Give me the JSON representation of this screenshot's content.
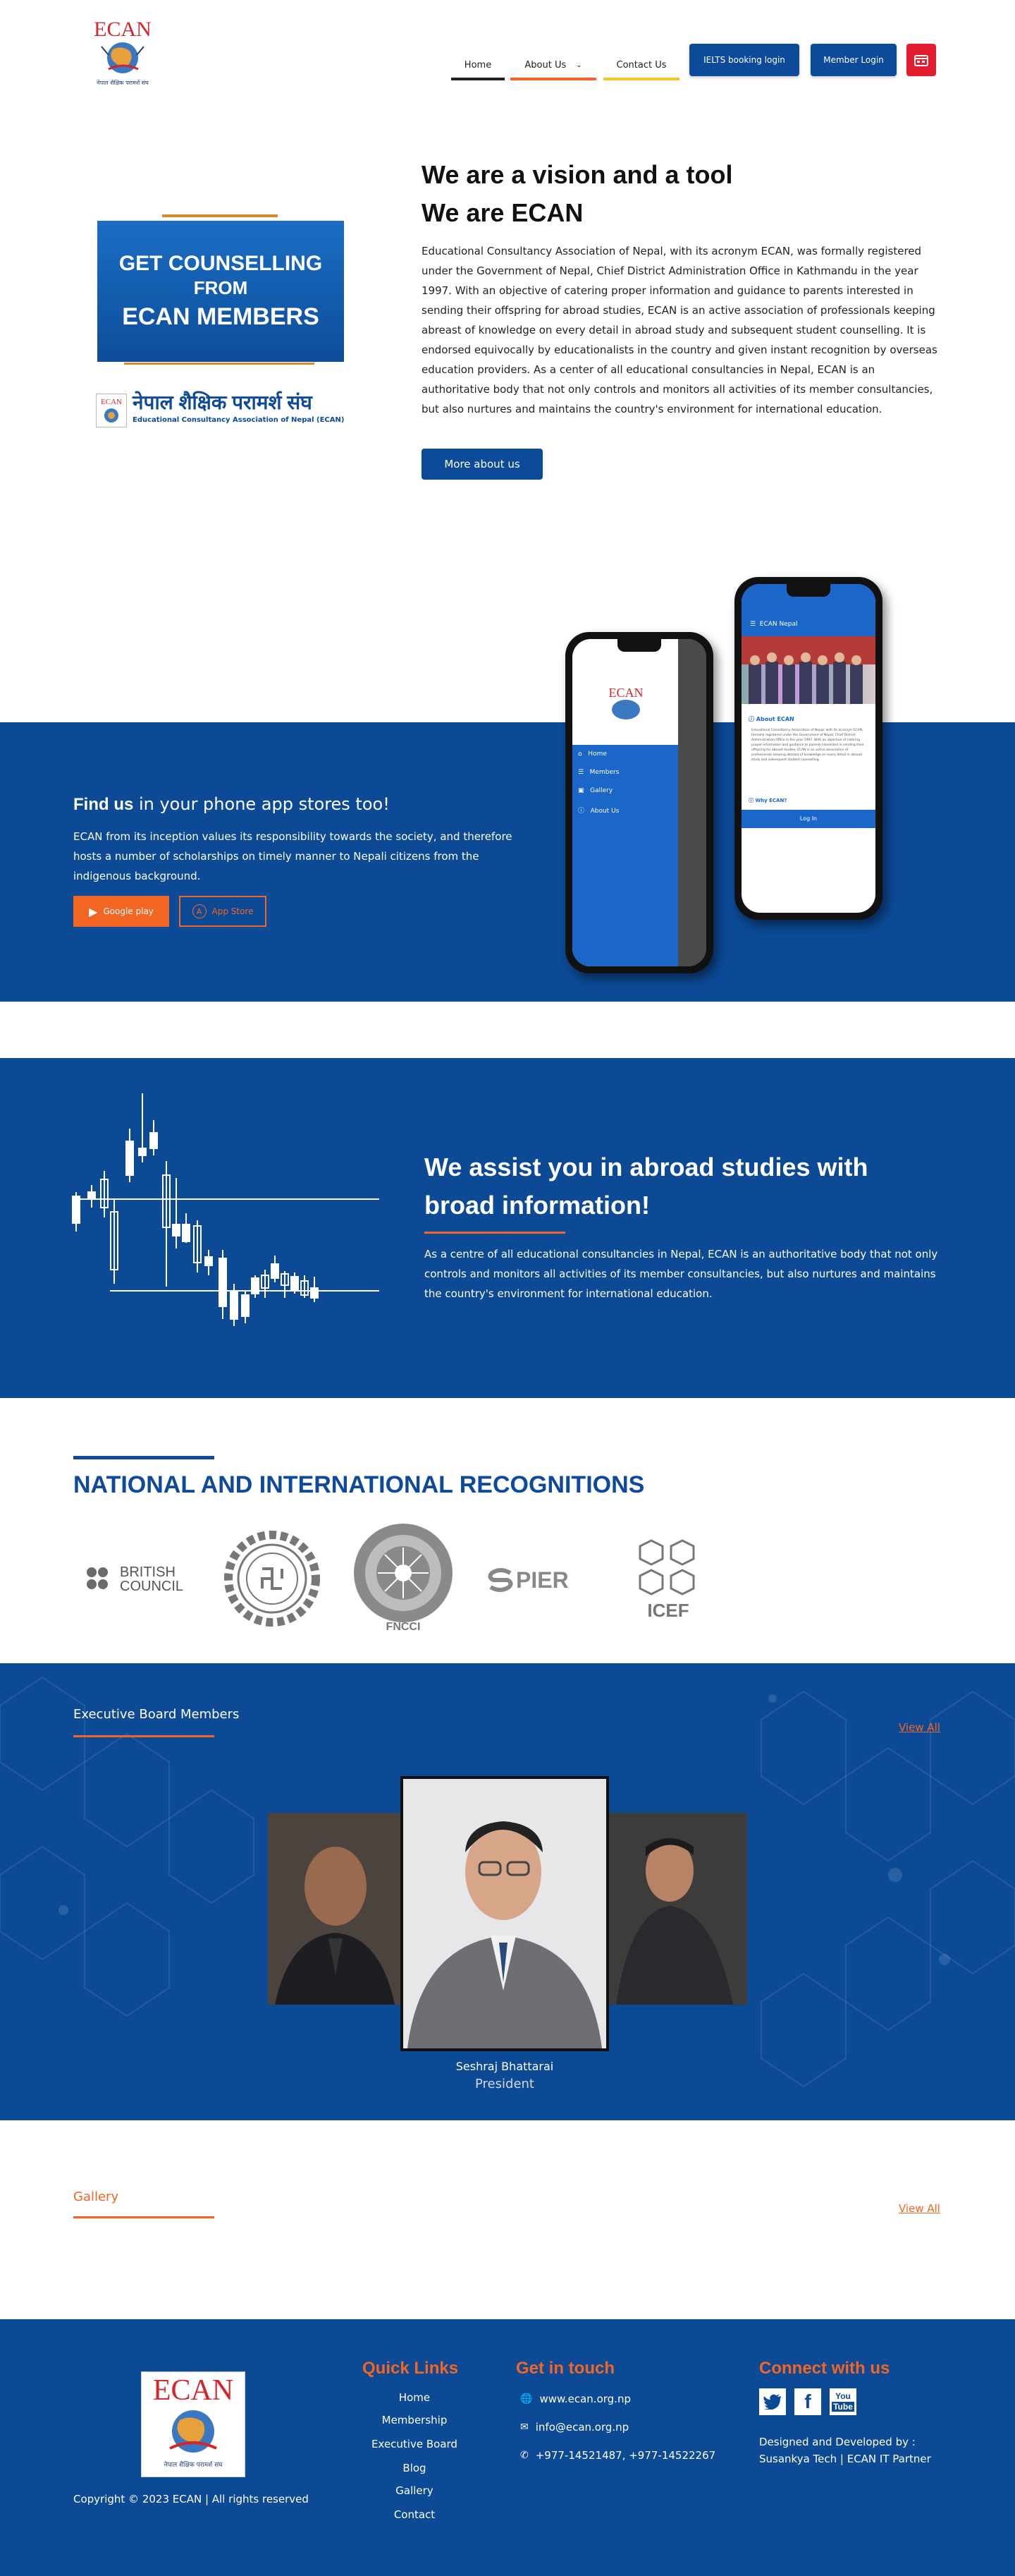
{
  "header": {
    "logo_text": "ECAN",
    "logo_sub": "नेपाल शैक्षिक परामर्श संघ",
    "nav": [
      {
        "label": "Home",
        "color": "#222222"
      },
      {
        "label": "About Us",
        "color": "#f26522"
      },
      {
        "label": "Contact Us",
        "color": "#f7c51d"
      }
    ],
    "ielts_label": "IELTS booking login",
    "member_label": "Member Login",
    "calendar_icon": "calendar-icon"
  },
  "about": {
    "counsel_line1": "GET COUNSELLING",
    "counsel_line2": "FROM",
    "counsel_line3": "ECAN MEMBERS",
    "ecan_nepali": "नेपाल शैक्षिक परामर्श संघ",
    "ecan_english": "Educational Consultancy Association of Nepal (ECAN)",
    "title1": "We are a vision and a tool",
    "title2": "We are ECAN",
    "paragraph": "Educational Consultancy Association of Nepal, with its acronym ECAN, was formally registered under the Government of Nepal, Chief District Administration Office in Kathmandu in the year 1997. With an objective of catering proper information and guidance to parents interested in sending their offspring for abroad studies, ECAN is an active association of professionals keeping abreast of knowledge on every detail in abroad study and subsequent student counselling. It is endorsed equivocally by educationalists in the country and given instant recognition by overseas education providers. As a center of all educational consultancies in Nepal, ECAN is an authoritative body that not only controls and monitors all activities of its member consultancies, but also nurtures and maintains the country's environment for international education.",
    "more_btn": "More about us"
  },
  "app": {
    "title_bold": "Find us",
    "title_rest": " in your phone app stores too!",
    "paragraph": "ECAN from its inception values its responsibility towards the society, and therefore hosts a number of scholarships on timely manner to Nepali citizens from the indigenous background.",
    "google_play": "Google play",
    "app_store": "App Store",
    "phone1": {
      "menu": [
        "Home",
        "Members",
        "Gallery",
        "About Us"
      ]
    },
    "phone2": {
      "header": "ECAN Nepal",
      "section": "About ECAN",
      "text": "Educational Consultancy Association of Nepal, with its acronym ECAN, formally registered under the Government of Nepal, Chief District Administration Office in the year 1997. With an objective of catering proper information and guidance to parents interested in sending their offspring for abroad studies, ECAN is an active association of professionals keeping abreast of knowledge on every detail in abroad study and subsequent student counselling.",
      "why": "Why ECAN?",
      "login": "Log In"
    }
  },
  "assist": {
    "title": "We assist you in abroad studies with broad information!",
    "paragraph": "As a centre of all educational consultancies in Nepal, ECAN is an authoritative body that not only controls and monitors all activities of its member consultancies, but also nurtures and maintains the country's environment for international education."
  },
  "recognitions": {
    "title": "NATIONAL AND INTERNATIONAL RECOGNITIONS",
    "british_1": "BRITISH",
    "british_2": "COUNCIL",
    "fncci": "FNCCI",
    "spier": "PIER",
    "icef": "ICEF"
  },
  "board": {
    "title": "Executive Board Members",
    "view_all": "View All",
    "member_name": "Seshraj Bhattarai",
    "member_role": "President"
  },
  "gallery": {
    "title": "Gallery",
    "view_all": "View All"
  },
  "footer": {
    "logo_text": "ECAN",
    "logo_sub": "नेपाल शैक्षिक परामर्श संघ",
    "copyright": "Copyright © 2023 ECAN | All rights reserved",
    "quick_title": "Quick Links",
    "quick_links": [
      "Home",
      "Membership",
      "Executive Board",
      "Blog",
      "Gallery",
      "Contact"
    ],
    "touch_title": "Get in touch",
    "website": "www.ecan.org.np",
    "email": "info@ecan.org.np",
    "phone": "+977-14521487, +977-14522267",
    "connect_title": "Connect with us",
    "designed_1": "Designed and Developed by :",
    "designed_2": "Susankya Tech | ECAN IT Partner"
  }
}
